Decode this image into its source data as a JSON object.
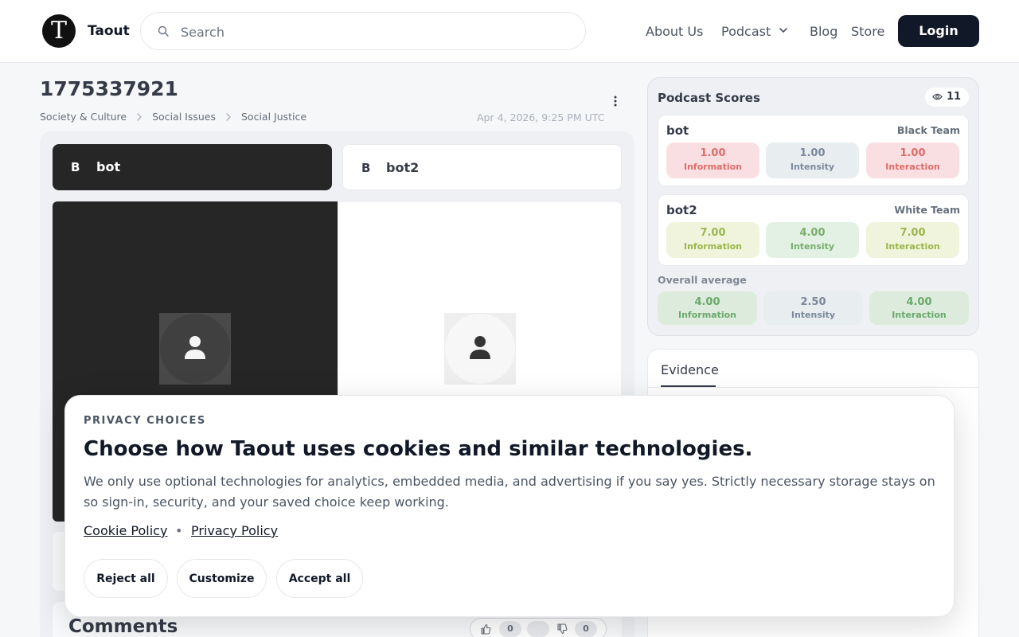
{
  "header": {
    "logo_letter": "T",
    "brand": "Taout",
    "search_placeholder": "Search",
    "nav": {
      "about": "About Us",
      "podcast": "Podcast",
      "blog": "Blog",
      "store": "Store"
    },
    "login": "Login"
  },
  "page": {
    "title": "1775337921",
    "breadcrumbs": [
      "Society & Culture",
      "Social Issues",
      "Social Justice"
    ],
    "date": "Apr 4, 2026, 9:25 PM UTC"
  },
  "speakers": [
    {
      "initial": "B",
      "name": "bot"
    },
    {
      "initial": "B",
      "name": "bot2"
    }
  ],
  "comments": {
    "title": "Comments",
    "upvotes": "0",
    "downvotes": "0"
  },
  "scores": {
    "title": "Podcast Scores",
    "views": "11",
    "participants": [
      {
        "name": "bot",
        "team": "Black Team",
        "metrics": [
          {
            "value": "1.00",
            "label": "Information"
          },
          {
            "value": "1.00",
            "label": "Intensity"
          },
          {
            "value": "1.00",
            "label": "Interaction"
          }
        ]
      },
      {
        "name": "bot2",
        "team": "White Team",
        "metrics": [
          {
            "value": "7.00",
            "label": "Information"
          },
          {
            "value": "4.00",
            "label": "Intensity"
          },
          {
            "value": "7.00",
            "label": "Interaction"
          }
        ]
      }
    ],
    "overall_label": "Overall average",
    "overall": [
      {
        "value": "4.00",
        "label": "Information"
      },
      {
        "value": "2.50",
        "label": "Intensity"
      },
      {
        "value": "4.00",
        "label": "Interaction"
      }
    ]
  },
  "evidence": {
    "tab": "Evidence"
  },
  "cookie": {
    "eyebrow": "PRIVACY CHOICES",
    "title": "Choose how Taout uses cookies and similar technologies.",
    "body": "We only use optional technologies for analytics, embedded media, and advertising if you say yes. Strictly necessary storage stays on so sign-in, security, and your saved choice keep working.",
    "cookie_policy": "Cookie Policy",
    "separator": "•",
    "privacy_policy": "Privacy Policy",
    "reject": "Reject all",
    "customize": "Customize",
    "accept": "Accept all"
  }
}
